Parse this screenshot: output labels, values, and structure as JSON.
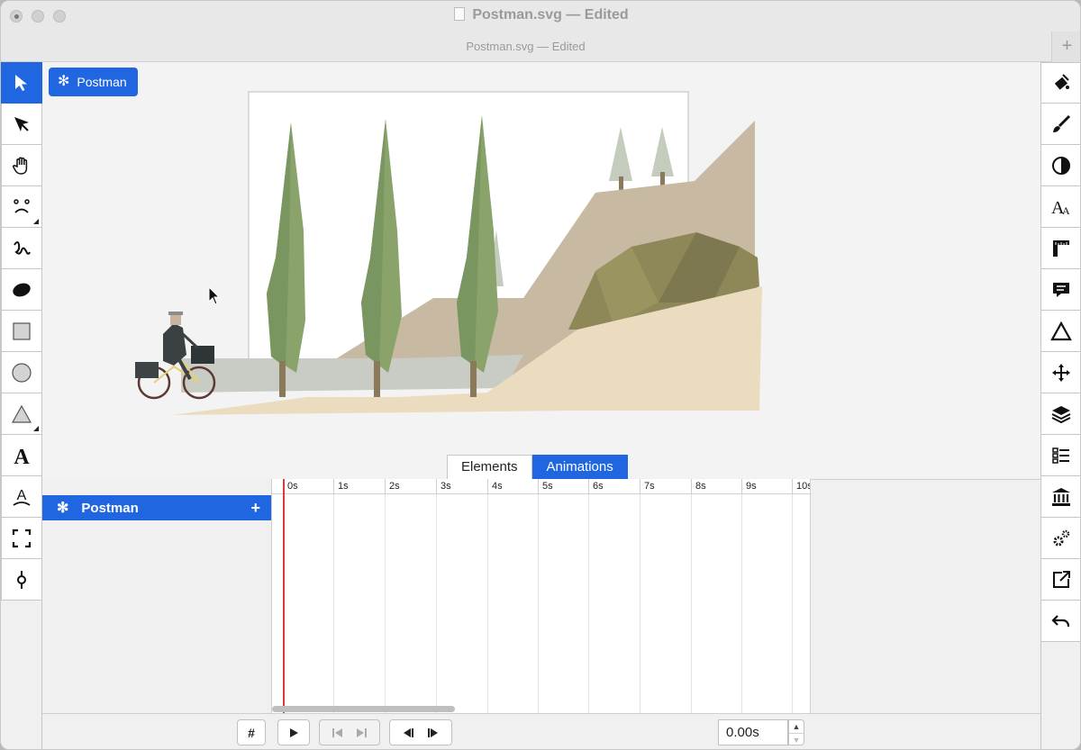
{
  "window": {
    "title": "Postman.svg — Edited",
    "tab_title": "Postman.svg — Edited",
    "new_tab": "+"
  },
  "left_toolbar": {
    "tools": [
      "select-arrow-icon",
      "direct-select-icon",
      "hand-icon",
      "face-icon",
      "freehand-icon",
      "ellipse-fill-icon",
      "rectangle-icon",
      "circle-icon",
      "triangle-icon",
      "text-icon",
      "text-path-icon",
      "crop-icon",
      "connector-icon"
    ],
    "active": "select-arrow-icon"
  },
  "right_toolbar": {
    "tools": [
      "paint-bucket-icon",
      "brush-icon",
      "contrast-icon",
      "font-icon",
      "ruler-icon",
      "comment-icon",
      "triangle-outline-icon",
      "move-icon",
      "layers-icon",
      "list-icon",
      "library-icon",
      "gears-icon",
      "export-icon",
      "undo-icon"
    ]
  },
  "canvas": {
    "selection_chip": {
      "icon": "✻",
      "label": "Postman"
    }
  },
  "segmented": {
    "elements": "Elements",
    "animations": "Animations",
    "selected": "Animations"
  },
  "layers": [
    {
      "icon": "✻",
      "name": "Postman",
      "add": "+"
    }
  ],
  "timeline": {
    "ticks": [
      "0s",
      "1s",
      "2s",
      "3s",
      "4s",
      "5s",
      "6s",
      "7s",
      "8s",
      "9s",
      "10s"
    ],
    "playhead": "0s"
  },
  "playback": {
    "grid": "#",
    "time_value": "0.00s"
  },
  "colors": {
    "accent": "#1f66e0",
    "playhead": "#d93a3a"
  }
}
